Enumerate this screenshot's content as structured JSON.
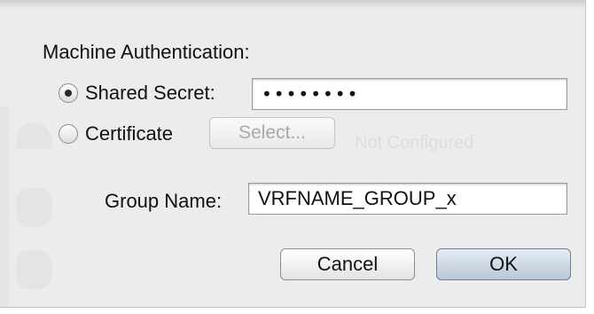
{
  "dialog": {
    "section_title": "Machine Authentication:",
    "shared_secret": {
      "label": "Shared Secret:",
      "selected": true,
      "value": "••••••••"
    },
    "certificate": {
      "label": "Certificate",
      "selected": false,
      "select_button_label": "Select..."
    },
    "group_name": {
      "label": "Group Name:",
      "value": "VRFNAME_GROUP_x"
    },
    "buttons": {
      "cancel": "Cancel",
      "ok": "OK"
    }
  },
  "background": {
    "status_text": "Not Configured"
  }
}
